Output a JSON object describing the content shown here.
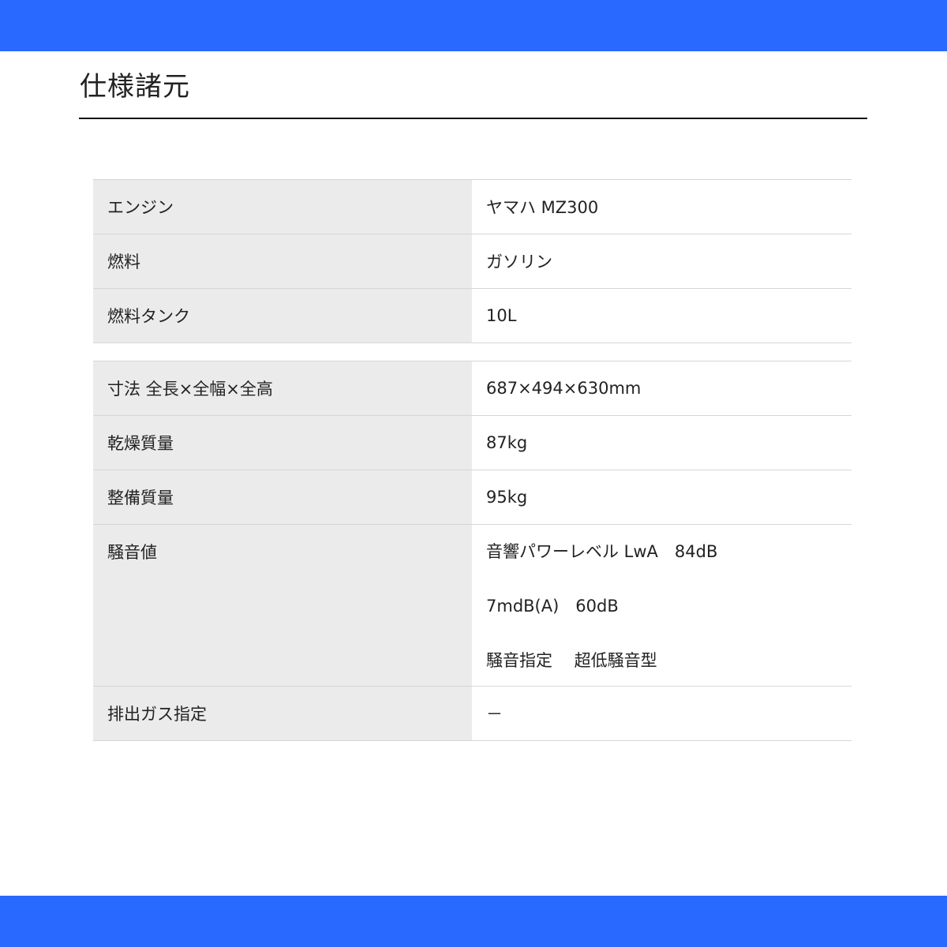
{
  "colors": {
    "brand_bar": "#2969ff",
    "label_bg": "#ebebeb",
    "rule": "#111111",
    "divider": "#d6d6d6"
  },
  "page": {
    "title": "仕様諸元"
  },
  "spec_group_1": [
    {
      "label": "エンジン",
      "value": "ヤマハ MZ300"
    },
    {
      "label": "燃料",
      "value": "ガソリン"
    },
    {
      "label": "燃料タンク",
      "value": "10L"
    }
  ],
  "spec_group_2": {
    "dimensions": {
      "label": "寸法 全長×全幅×全高",
      "value": "687×494×630mm"
    },
    "dry_weight": {
      "label": "乾燥質量",
      "value": "87kg"
    },
    "service_weight": {
      "label": "整備質量",
      "value": "95kg"
    },
    "noise": {
      "label": "騒音値",
      "lines": [
        "音響パワーレベル LwA　84dB",
        "7mdB(A)　60dB",
        "騒音指定　 超低騒音型"
      ]
    },
    "exhaust": {
      "label": "排出ガス指定",
      "value": "－"
    }
  }
}
